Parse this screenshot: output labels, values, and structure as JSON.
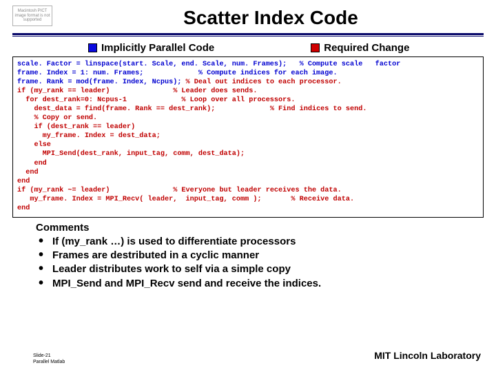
{
  "pict_placeholder": "Macintosh PICT image format is not supported",
  "title": "Scatter Index Code",
  "legend": {
    "blue": "Implicitly Parallel Code",
    "red": "Required Change"
  },
  "code": {
    "l01a": "scale. Factor = linspace(start. Scale, end. Scale, num. Frames);   % Compute scale   factor",
    "l02a": "frame. Index = 1: num. Frames;             % Compute indices for each image.",
    "l03a": "frame. Rank = mod(frame. Index, Ncpus);",
    "l03b": " % Deal out indices to each processor.",
    "l04a": "if (my_rank == leader)",
    "l04b": "               % Leader does sends.",
    "l05a": "  for dest_rank=0: Ncpus-1",
    "l05b": "             % Loop over all processors.",
    "l06a": "    dest_data = find(frame. Rank == dest_rank);",
    "l06b": "             % Find indices to send.",
    "l07a": "    % Copy or send.",
    "l08a": "    if (dest_rank == leader)",
    "l09a": "      my_frame. Index = dest_data;",
    "l10a": "    else",
    "l11a": "      MPI_Send(dest_rank, input_tag, comm, dest_data);",
    "l12a": "    end",
    "l13a": "  end",
    "l14a": "end",
    "l15a": "if (my_rank ~= leader)",
    "l15b": "               % Everyone but leader receives the data.",
    "l16a": "   my_frame. Index = MPI_Recv( leader,  input_tag, comm );",
    "l16b": "       % Receive data.",
    "l17a": "end"
  },
  "comments": {
    "heading": "Comments",
    "items": [
      "If (my_rank …)   is used to differentiate processors",
      "Frames are destributed in a cyclic manner",
      "Leader distributes work to self via a simple copy",
      "MPI_Send and MPI_Recv send and receive the indices."
    ]
  },
  "footer": {
    "left_line1": "Slide-21",
    "left_line2": "Parallel Matlab",
    "right": "MIT Lincoln Laboratory"
  }
}
